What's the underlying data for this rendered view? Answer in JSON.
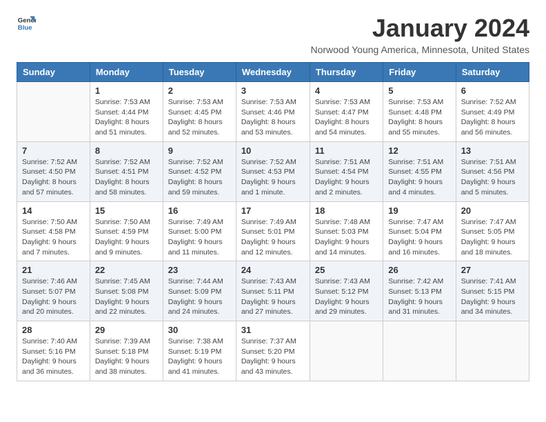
{
  "logo": {
    "line1": "General",
    "line2": "Blue"
  },
  "title": "January 2024",
  "subtitle": "Norwood Young America, Minnesota, United States",
  "days_of_week": [
    "Sunday",
    "Monday",
    "Tuesday",
    "Wednesday",
    "Thursday",
    "Friday",
    "Saturday"
  ],
  "weeks": [
    [
      {
        "day": "",
        "info": ""
      },
      {
        "day": "1",
        "info": "Sunrise: 7:53 AM\nSunset: 4:44 PM\nDaylight: 8 hours\nand 51 minutes."
      },
      {
        "day": "2",
        "info": "Sunrise: 7:53 AM\nSunset: 4:45 PM\nDaylight: 8 hours\nand 52 minutes."
      },
      {
        "day": "3",
        "info": "Sunrise: 7:53 AM\nSunset: 4:46 PM\nDaylight: 8 hours\nand 53 minutes."
      },
      {
        "day": "4",
        "info": "Sunrise: 7:53 AM\nSunset: 4:47 PM\nDaylight: 8 hours\nand 54 minutes."
      },
      {
        "day": "5",
        "info": "Sunrise: 7:53 AM\nSunset: 4:48 PM\nDaylight: 8 hours\nand 55 minutes."
      },
      {
        "day": "6",
        "info": "Sunrise: 7:52 AM\nSunset: 4:49 PM\nDaylight: 8 hours\nand 56 minutes."
      }
    ],
    [
      {
        "day": "7",
        "info": "Sunrise: 7:52 AM\nSunset: 4:50 PM\nDaylight: 8 hours\nand 57 minutes."
      },
      {
        "day": "8",
        "info": "Sunrise: 7:52 AM\nSunset: 4:51 PM\nDaylight: 8 hours\nand 58 minutes."
      },
      {
        "day": "9",
        "info": "Sunrise: 7:52 AM\nSunset: 4:52 PM\nDaylight: 8 hours\nand 59 minutes."
      },
      {
        "day": "10",
        "info": "Sunrise: 7:52 AM\nSunset: 4:53 PM\nDaylight: 9 hours\nand 1 minute."
      },
      {
        "day": "11",
        "info": "Sunrise: 7:51 AM\nSunset: 4:54 PM\nDaylight: 9 hours\nand 2 minutes."
      },
      {
        "day": "12",
        "info": "Sunrise: 7:51 AM\nSunset: 4:55 PM\nDaylight: 9 hours\nand 4 minutes."
      },
      {
        "day": "13",
        "info": "Sunrise: 7:51 AM\nSunset: 4:56 PM\nDaylight: 9 hours\nand 5 minutes."
      }
    ],
    [
      {
        "day": "14",
        "info": "Sunrise: 7:50 AM\nSunset: 4:58 PM\nDaylight: 9 hours\nand 7 minutes."
      },
      {
        "day": "15",
        "info": "Sunrise: 7:50 AM\nSunset: 4:59 PM\nDaylight: 9 hours\nand 9 minutes."
      },
      {
        "day": "16",
        "info": "Sunrise: 7:49 AM\nSunset: 5:00 PM\nDaylight: 9 hours\nand 11 minutes."
      },
      {
        "day": "17",
        "info": "Sunrise: 7:49 AM\nSunset: 5:01 PM\nDaylight: 9 hours\nand 12 minutes."
      },
      {
        "day": "18",
        "info": "Sunrise: 7:48 AM\nSunset: 5:03 PM\nDaylight: 9 hours\nand 14 minutes."
      },
      {
        "day": "19",
        "info": "Sunrise: 7:47 AM\nSunset: 5:04 PM\nDaylight: 9 hours\nand 16 minutes."
      },
      {
        "day": "20",
        "info": "Sunrise: 7:47 AM\nSunset: 5:05 PM\nDaylight: 9 hours\nand 18 minutes."
      }
    ],
    [
      {
        "day": "21",
        "info": "Sunrise: 7:46 AM\nSunset: 5:07 PM\nDaylight: 9 hours\nand 20 minutes."
      },
      {
        "day": "22",
        "info": "Sunrise: 7:45 AM\nSunset: 5:08 PM\nDaylight: 9 hours\nand 22 minutes."
      },
      {
        "day": "23",
        "info": "Sunrise: 7:44 AM\nSunset: 5:09 PM\nDaylight: 9 hours\nand 24 minutes."
      },
      {
        "day": "24",
        "info": "Sunrise: 7:43 AM\nSunset: 5:11 PM\nDaylight: 9 hours\nand 27 minutes."
      },
      {
        "day": "25",
        "info": "Sunrise: 7:43 AM\nSunset: 5:12 PM\nDaylight: 9 hours\nand 29 minutes."
      },
      {
        "day": "26",
        "info": "Sunrise: 7:42 AM\nSunset: 5:13 PM\nDaylight: 9 hours\nand 31 minutes."
      },
      {
        "day": "27",
        "info": "Sunrise: 7:41 AM\nSunset: 5:15 PM\nDaylight: 9 hours\nand 34 minutes."
      }
    ],
    [
      {
        "day": "28",
        "info": "Sunrise: 7:40 AM\nSunset: 5:16 PM\nDaylight: 9 hours\nand 36 minutes."
      },
      {
        "day": "29",
        "info": "Sunrise: 7:39 AM\nSunset: 5:18 PM\nDaylight: 9 hours\nand 38 minutes."
      },
      {
        "day": "30",
        "info": "Sunrise: 7:38 AM\nSunset: 5:19 PM\nDaylight: 9 hours\nand 41 minutes."
      },
      {
        "day": "31",
        "info": "Sunrise: 7:37 AM\nSunset: 5:20 PM\nDaylight: 9 hours\nand 43 minutes."
      },
      {
        "day": "",
        "info": ""
      },
      {
        "day": "",
        "info": ""
      },
      {
        "day": "",
        "info": ""
      }
    ]
  ]
}
